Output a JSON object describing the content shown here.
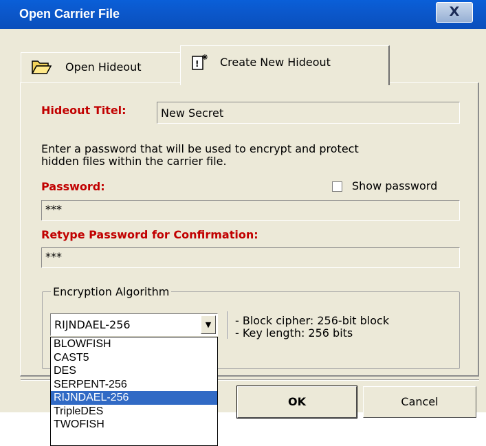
{
  "window": {
    "title": "Open Carrier File",
    "close_glyph": "X"
  },
  "tabs": [
    {
      "label": "Open Hideout",
      "icon": "folder-open-icon"
    },
    {
      "label": "Create New Hideout",
      "icon": "new-document-icon",
      "active": true
    }
  ],
  "form": {
    "title_label": "Hideout Titel:",
    "title_value": "New Secret",
    "instructions_line1": "Enter a password that will be used to encrypt and protect",
    "instructions_line2": "hidden files within the carrier file.",
    "password_label": "Password:",
    "show_password_label": "Show password",
    "show_password_checked": false,
    "password_value": "***",
    "retype_label": "Retype Password for Confirmation:",
    "retype_value": "***"
  },
  "encryption": {
    "group_label": "Encryption Algorithm",
    "selected": "RIJNDAEL-256",
    "info_line1": "- Block cipher: 256-bit block",
    "info_line2": "- Key length: 256 bits",
    "options": [
      "BLOWFISH",
      "CAST5",
      "DES",
      "SERPENT-256",
      "RIJNDAEL-256",
      "TripleDES",
      "TWOFISH"
    ],
    "highlighted_index": 4
  },
  "buttons": {
    "ok": "OK",
    "cancel": "Cancel"
  },
  "colors": {
    "titlebar": "#0b58cc",
    "label_red": "#c10000",
    "highlight": "#316ac5",
    "face": "#ece9d8"
  }
}
